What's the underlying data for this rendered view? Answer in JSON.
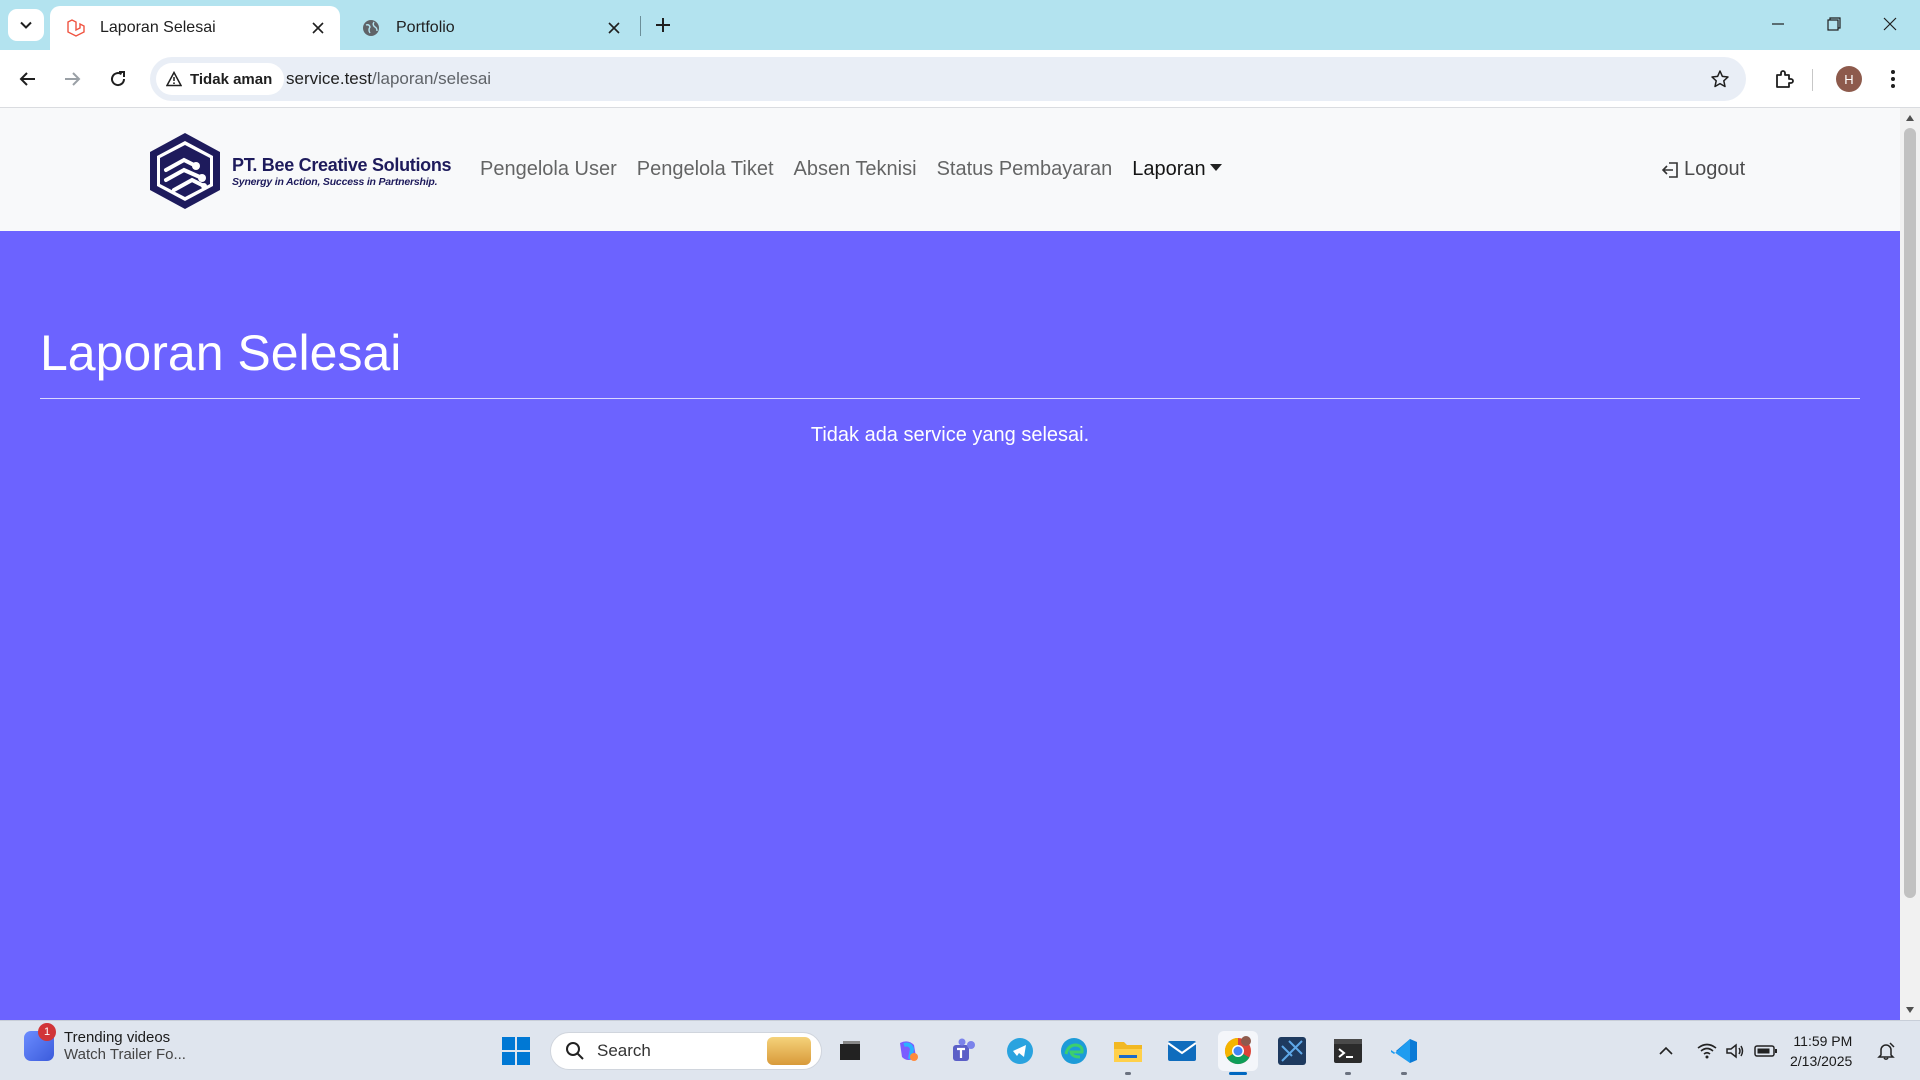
{
  "browser": {
    "tabs": [
      {
        "title": "Laporan Selesai",
        "active": true,
        "icon": "laravel-icon"
      },
      {
        "title": "Portfolio",
        "active": false,
        "icon": "globe-icon"
      }
    ],
    "security_label": "Tidak aman",
    "url_host": "service.test",
    "url_path": "/laporan/selesai",
    "profile_initial": "H"
  },
  "site": {
    "brand_name": "PT. Bee Creative Solutions",
    "brand_tagline": "Synergy in Action, Success in Partnership.",
    "nav": [
      {
        "label": "Pengelola User"
      },
      {
        "label": "Pengelola Tiket"
      },
      {
        "label": "Absen Teknisi"
      },
      {
        "label": "Status Pembayaran"
      },
      {
        "label": "Laporan"
      }
    ],
    "logout_label": "Logout",
    "accent_color": "#6c63ff"
  },
  "page": {
    "title": "Laporan Selesai",
    "empty_message": "Tidak ada service yang selesai."
  },
  "taskbar": {
    "widget_title": "Trending videos",
    "widget_subtitle": "Watch Trailer Fo...",
    "widget_badge": "1",
    "search_placeholder": "Search",
    "time": "11:59 PM",
    "date": "2/13/2025"
  }
}
